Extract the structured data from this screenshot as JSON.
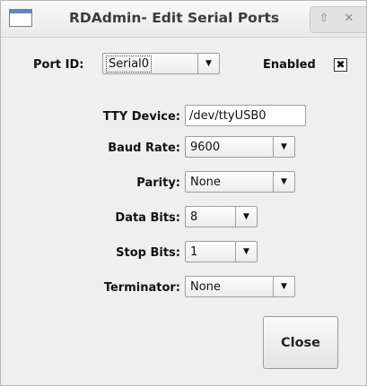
{
  "window": {
    "title": "RDAdmin- Edit Serial Ports",
    "controls": {
      "shade_icon": "⇧",
      "close_icon": "✕"
    }
  },
  "port": {
    "label": "Port ID:",
    "value": "Serial0",
    "enabled_label": "Enabled",
    "enabled_checked": true,
    "enabled_mark": "✖"
  },
  "settings": {
    "tty_device": {
      "label": "TTY Device:",
      "value": "/dev/ttyUSB0"
    },
    "baud_rate": {
      "label": "Baud Rate:",
      "value": "9600"
    },
    "parity": {
      "label": "Parity:",
      "value": "None"
    },
    "data_bits": {
      "label": "Data Bits:",
      "value": "8"
    },
    "stop_bits": {
      "label": "Stop Bits:",
      "value": "1"
    },
    "terminator": {
      "label": "Terminator:",
      "value": "None"
    }
  },
  "dropdown_arrow": "▼",
  "buttons": {
    "close_label": "Close"
  }
}
